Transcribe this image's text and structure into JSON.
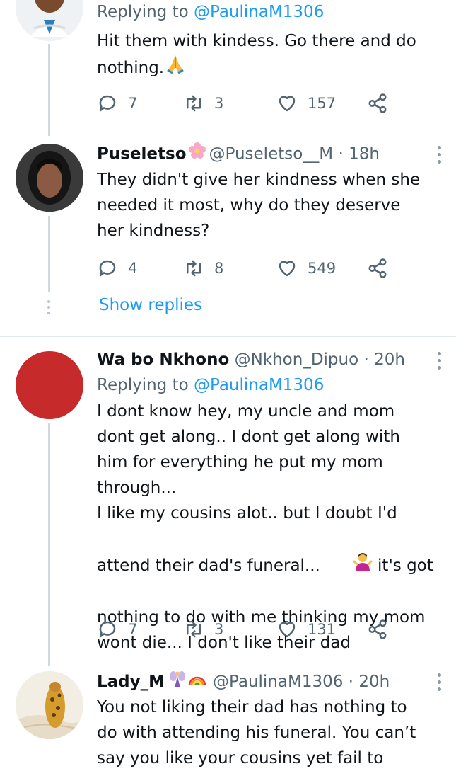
{
  "tweets": [
    {
      "replying_prefix": "Replying to ",
      "replying_mention": "@PaulinaM1306",
      "text_lines": [
        "Hit them with kindess. Go there and do",
        "nothing."
      ],
      "replies": "7",
      "retweets": "3",
      "likes": "157"
    },
    {
      "name": "Puseletso",
      "handle": "@Puseletso__M",
      "separator": " · ",
      "time": "18h",
      "text_lines": [
        "They didn't give her kindness when she",
        "needed it most, why do they deserve",
        "her kindness?"
      ],
      "replies": "4",
      "retweets": "8",
      "likes": "549",
      "show_replies": "Show replies"
    },
    {
      "name": "Wa bo Nkhono",
      "handle": "@Nkhon_Dipuo",
      "separator": " · ",
      "time": "20h",
      "replying_prefix": "Replying to ",
      "replying_mention": "@PaulinaM1306",
      "text_lines": [
        "I dont know hey, my uncle and mom",
        "dont get along.. I dont get along with",
        "him for everything he put my mom",
        "through...",
        "I like my cousins alot.. but I doubt I'd",
        "attend their dad's funeral...",
        " it's got",
        "nothing to do with me thinking my mom",
        "wont die... I don't like their dad"
      ],
      "replies": "7",
      "retweets": "3",
      "likes": "131",
      "avatar_color": "#c62a2a"
    },
    {
      "name": "Lady_M",
      "handle": "@PaulinaM1306",
      "separator": " · ",
      "time": "20h",
      "text_lines": [
        "You not liking their dad has nothing to",
        "do with attending his funeral. You can’t",
        "say you like your cousins yet fail to"
      ]
    }
  ],
  "colors": {
    "accent": "#1d9bf0",
    "muted": "#536471",
    "text": "#0f1419",
    "line": "#cfd9de"
  },
  "icons": {
    "reply": "reply-icon",
    "retweet": "retweet-icon",
    "like": "heart-icon",
    "share": "share-icon",
    "more": "more-vertical-icon"
  }
}
